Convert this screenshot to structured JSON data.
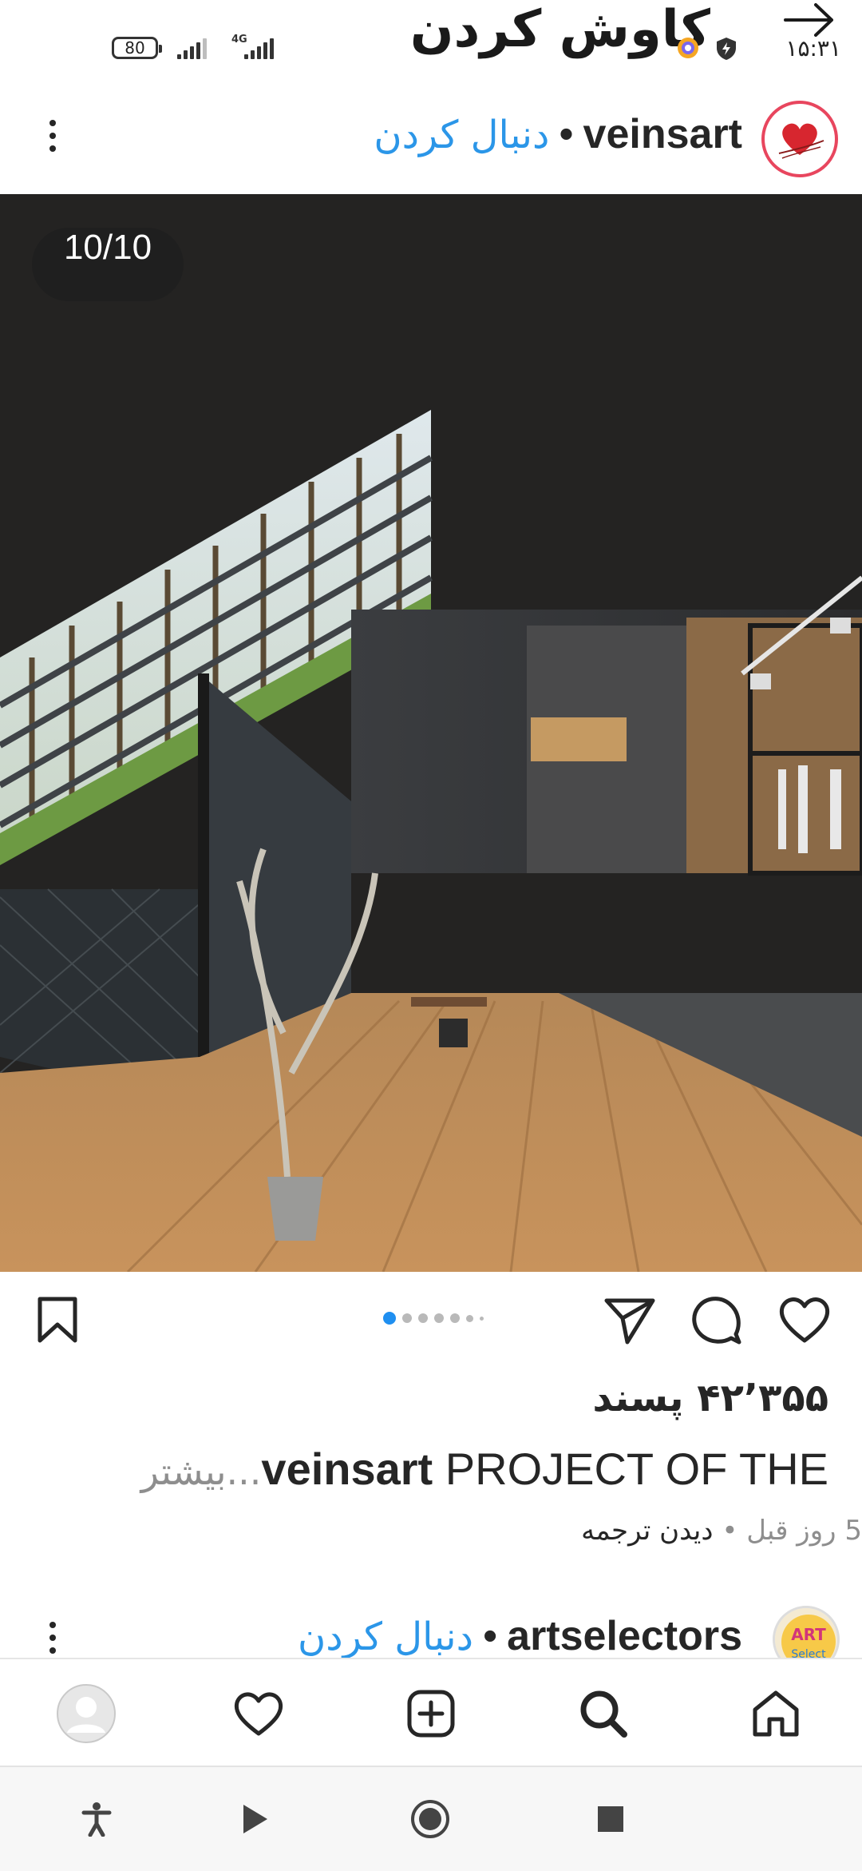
{
  "status_bar": {
    "battery": "80",
    "network": "4G",
    "title": "کاوش کردن",
    "time": "۱۵:۳۱"
  },
  "post": {
    "username": "veinsart",
    "separator": "•",
    "follow_label": "دنبال کردن",
    "media_counter": "10/10",
    "carousel": {
      "total_dots": 7,
      "active_index": 0
    },
    "likes": "۴۲٬۳۵۵ پسند",
    "caption_username": "veinsart",
    "caption_text": "PROJECT OF THE",
    "caption_more": "...بیشتر",
    "time_ago": "5 روز قبل",
    "meta_sep": "•",
    "see_translation": "دیدن ترجمه"
  },
  "next_post": {
    "username": "artselectors",
    "separator": "•",
    "follow_label": "دنبال کردن",
    "avatar_text": "ART Select"
  },
  "tab_bar": {
    "items": [
      "home-icon",
      "search-icon",
      "add-icon",
      "heart-icon",
      "profile-icon"
    ]
  },
  "system_nav": {
    "items": [
      "accessibility-icon",
      "play-icon",
      "record-icon",
      "stop-icon"
    ]
  },
  "colors": {
    "accent": "#2b96e8",
    "dot_active": "#1f8ff0",
    "avatar_ring": "#e8465e",
    "text": "#262626",
    "muted": "#8e8e8e"
  }
}
